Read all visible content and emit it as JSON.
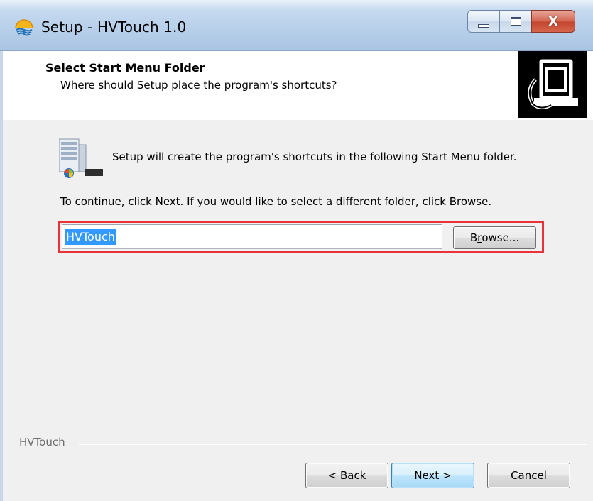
{
  "window": {
    "title": "Setup - HVTouch 1.0",
    "controls": {
      "minimize": "minimize",
      "maximize": "maximize",
      "close": "X"
    }
  },
  "header": {
    "title": "Select Start Menu Folder",
    "subtitle": "Where should Setup place the program's shortcuts?"
  },
  "body": {
    "info_text": "Setup will create the program's shortcuts in the following Start Menu folder.",
    "continue_text": "To continue, click Next. If you would like to select a different folder, click Browse.",
    "folder_input_value": "HVTouch",
    "browse": {
      "label_pre": "B",
      "label_accel": "r",
      "label_post": "owse..."
    }
  },
  "footer": {
    "brand": "HVTouch",
    "back": {
      "pre": "< ",
      "accel": "B",
      "post": "ack"
    },
    "next": {
      "accel": "N",
      "post": "ext >"
    },
    "cancel": "Cancel"
  },
  "colors": {
    "highlight_border": "#e8333a",
    "selection": "#3399ff",
    "dialog_background": "#f0f0f0"
  }
}
